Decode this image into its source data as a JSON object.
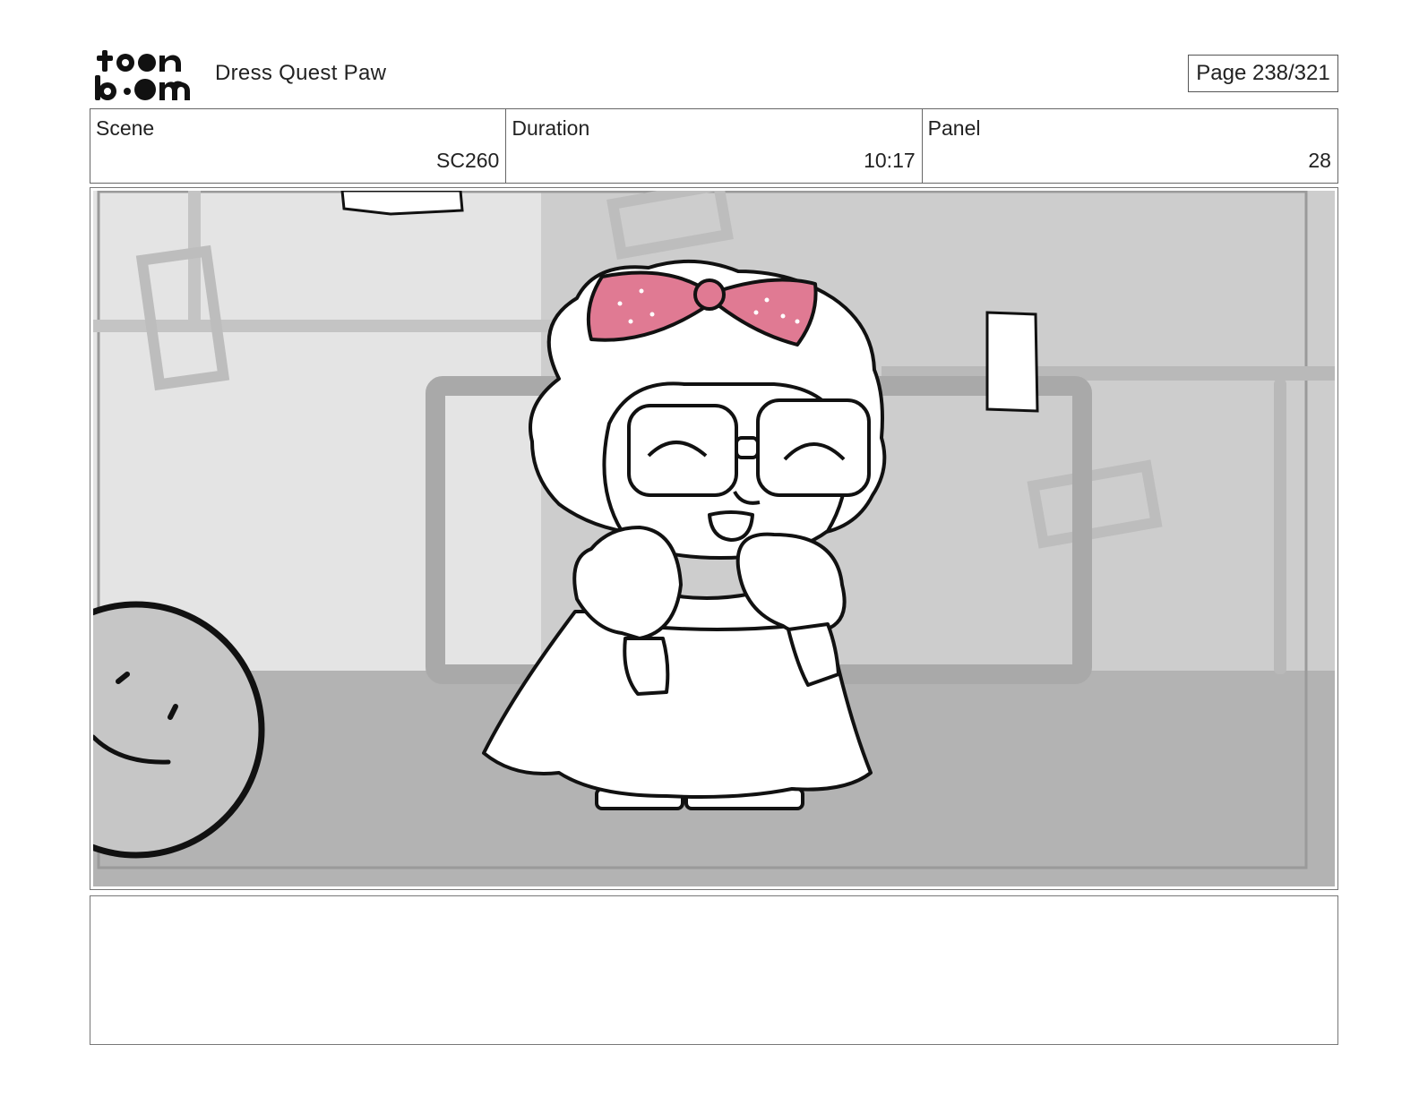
{
  "header": {
    "logo_text": "toon boom",
    "project_title": "Dress Quest Paw",
    "page_label": "Page 238/321"
  },
  "meta": {
    "scene_label": "Scene",
    "scene_value": "SC260",
    "duration_label": "Duration",
    "duration_value": "10:17",
    "panel_label": "Panel",
    "panel_value": "28"
  },
  "notes": {
    "text": ""
  },
  "colors": {
    "bow_pink": "#e07a93",
    "wall_light": "#e4e4e4",
    "wall_mid": "#cfcfcf",
    "floor": "#b3b3b3",
    "line": "#111111"
  }
}
